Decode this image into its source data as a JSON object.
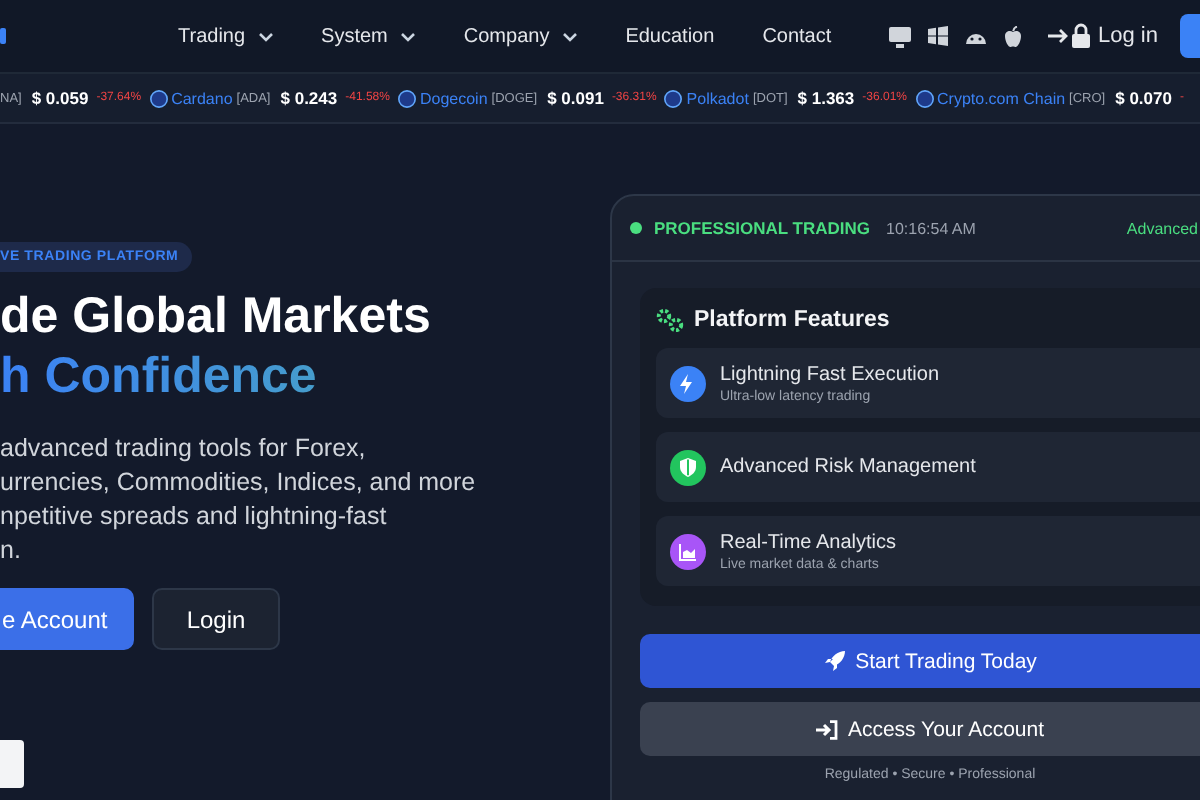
{
  "nav": {
    "items": [
      {
        "label": "Trading",
        "dropdown": true
      },
      {
        "label": "System",
        "dropdown": true
      },
      {
        "label": "Company",
        "dropdown": true
      },
      {
        "label": "Education",
        "dropdown": false
      },
      {
        "label": "Contact",
        "dropdown": false
      }
    ],
    "login": "Log in"
  },
  "ticker": [
    {
      "symbol": "NA]",
      "price": "$ 0.059",
      "change": "-37.64%"
    },
    {
      "name": "Cardano",
      "symbol": "[ADA]",
      "price": "$ 0.243",
      "change": "-41.58%"
    },
    {
      "name": "Dogecoin",
      "symbol": "[DOGE]",
      "price": "$ 0.091",
      "change": "-36.31%"
    },
    {
      "name": "Polkadot",
      "symbol": "[DOT]",
      "price": "$ 1.363",
      "change": "-36.01%"
    },
    {
      "name": "Crypto.com Chain",
      "symbol": "[CRO]",
      "price": "$ 0.070",
      "change": "-"
    }
  ],
  "hero": {
    "badge": "VE TRADING PLATFORM",
    "title_line_1": "de Global Markets",
    "title_line_2": "h Confidence",
    "description": [
      "advanced trading tools for Forex,",
      "urrencies, Commodities, Indices, and more",
      "npetitive spreads and lightning-fast",
      "n."
    ],
    "primary_button": "e Account",
    "secondary_button": "Login"
  },
  "panel": {
    "status": "PROFESSIONAL TRADING",
    "time": "10:16:54 AM",
    "tag": "Advanced",
    "features_title": "Platform Features",
    "features": [
      {
        "kind": "bolt",
        "title": "Lightning Fast Execution",
        "subtitle": "Ultra-low latency trading",
        "color": "#3b82f6"
      },
      {
        "kind": "shield",
        "title": "Advanced Risk Management",
        "color": "#22c55e"
      },
      {
        "kind": "chart",
        "title": "Real-Time Analytics",
        "subtitle": "Live market data & charts",
        "color": "#a855f7"
      }
    ],
    "start_button": "Start Trading Today",
    "access_button": "Access Your Account",
    "footnote": "Regulated • Secure • Professional"
  }
}
